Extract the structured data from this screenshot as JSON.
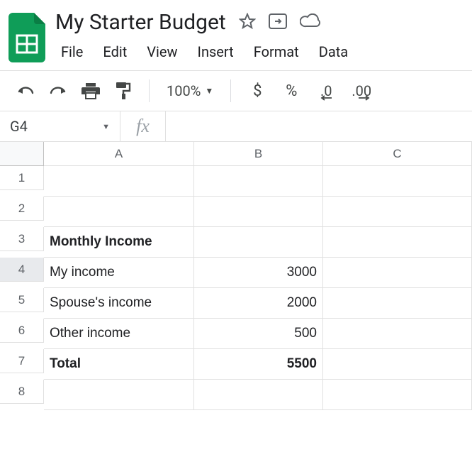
{
  "doc": {
    "title": "My Starter Budget"
  },
  "menu": {
    "file": "File",
    "edit": "Edit",
    "view": "View",
    "insert": "Insert",
    "format": "Format",
    "data": "Data"
  },
  "toolbar": {
    "zoom": "100%",
    "currency": "$",
    "percent": "%",
    "dec_decrease": ".0",
    "dec_increase": ".00"
  },
  "namebox": {
    "value": "G4"
  },
  "fx": {
    "symbol": "fx",
    "value": ""
  },
  "columns": [
    "A",
    "B",
    "C"
  ],
  "row_numbers": [
    "1",
    "2",
    "3",
    "4",
    "5",
    "6",
    "7",
    "8"
  ],
  "cells": {
    "A3": "Monthly Income",
    "A4": "My income",
    "B4": "3000",
    "A5": "Spouse's income",
    "B5": "2000",
    "A6": "Other income",
    "B6": "500",
    "A7": "Total",
    "B7": "5500"
  },
  "selected_row": "4"
}
